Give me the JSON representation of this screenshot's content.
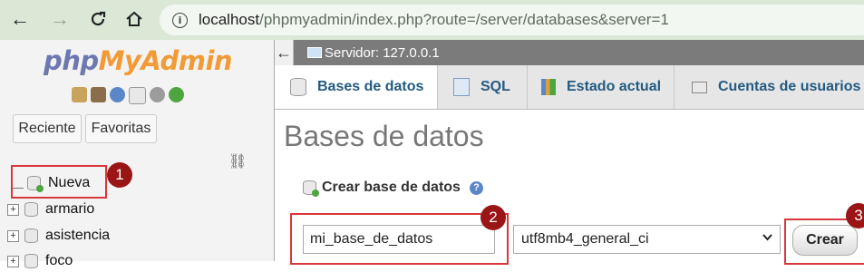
{
  "browser": {
    "back_icon": "arrow-left-icon",
    "forward_icon": "arrow-right-icon",
    "reload_icon": "reload-icon",
    "home_icon": "home-icon",
    "url_host": "localhost",
    "url_path": "/phpmyadmin/index.php?route=/server/databases&server=1"
  },
  "sidebar": {
    "logo_part1": "php",
    "logo_part2": "MyAdmin",
    "recent_label": "Reciente",
    "favorites_label": "Favoritas",
    "tree": [
      {
        "label": "Nueva"
      },
      {
        "label": "armario"
      },
      {
        "label": "asistencia"
      },
      {
        "label": "foco"
      }
    ]
  },
  "server": {
    "collapse_glyph": "←",
    "label": "Servidor: 127.0.0.1"
  },
  "tabs": [
    {
      "label": "Bases de datos"
    },
    {
      "label": "SQL"
    },
    {
      "label": "Estado actual"
    },
    {
      "label": "Cuentas de usuarios"
    }
  ],
  "main": {
    "title": "Bases de datos",
    "create_label": "Crear base de datos",
    "db_name_value": "mi_base_de_datos",
    "collation_value": "utf8mb4_general_ci",
    "create_button": "Crear"
  },
  "annotations": {
    "badge1": "1",
    "badge2": "2",
    "badge3": "3",
    "highlight_color": "#d8373b",
    "badge_color": "#9a1515"
  }
}
